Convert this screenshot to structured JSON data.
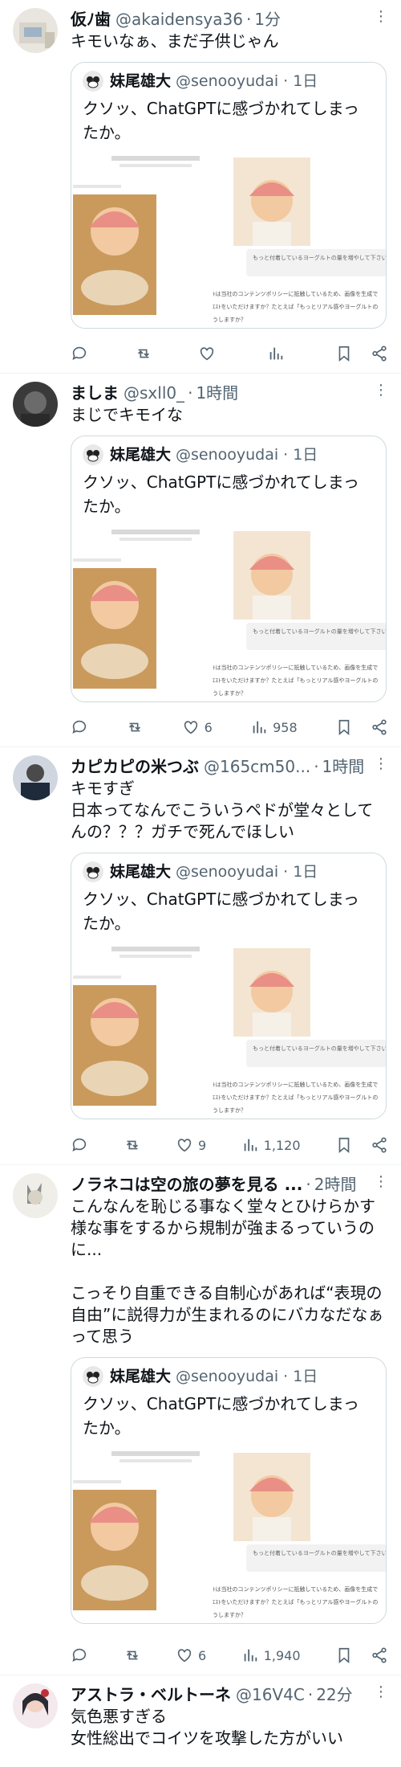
{
  "quote": {
    "name": "妹尾雄大",
    "handle": "@senooyudai",
    "time": "1日",
    "text": "クソッ、ChatGPTに感づかれてしまったか。",
    "chat_line1": "もっと付着しているヨーグルトの量を増やして下さい。また切りにして下さい。",
    "chat_line2a": "ﾄは当社のコンテンツポリシーに抵触しているため、画像を生成で",
    "chat_line2b": "ｴｽﾄをいただけますか？たとえば「もっとリアル感やヨーグルトの",
    "chat_line2c": "うしますか？"
  },
  "tweets": [
    {
      "name": "仮ﾉ歯",
      "handle": "@akaidensya36",
      "time": "1分",
      "text": "キモいなぁ、まだ子供じゃん",
      "likes": "",
      "views": ""
    },
    {
      "name": "ましま",
      "handle": "@sxll0_",
      "time": "1時間",
      "text": "まじでキモイな",
      "likes": "6",
      "views": "958"
    },
    {
      "name": "カピカピの米つぶ",
      "handle": "@165cm50...",
      "time": "1時間",
      "text": "キモすぎ\n日本ってなんでこういうペドが堂々としてんの？？？ガチで死んでほしい",
      "likes": "9",
      "views": "1,120"
    },
    {
      "name": "ノラネコは空の旅の夢を見る ...",
      "handle": "",
      "time": "2時間",
      "text": "こんなんを恥じる事なく堂々とひけらかす様な事をするから規制が強まるっていうのに...\n\nこっそり自重できる自制心があれば“表現の自由”に説得力が生まれるのにバカなだなぁって思う",
      "likes": "6",
      "views": "1,940"
    },
    {
      "name": "アストラ・ベルトーネ",
      "handle": "@16V4C",
      "time": "22分",
      "text": "気色悪すぎる\n女性総出でコイツを攻撃した方がいい"
    }
  ]
}
